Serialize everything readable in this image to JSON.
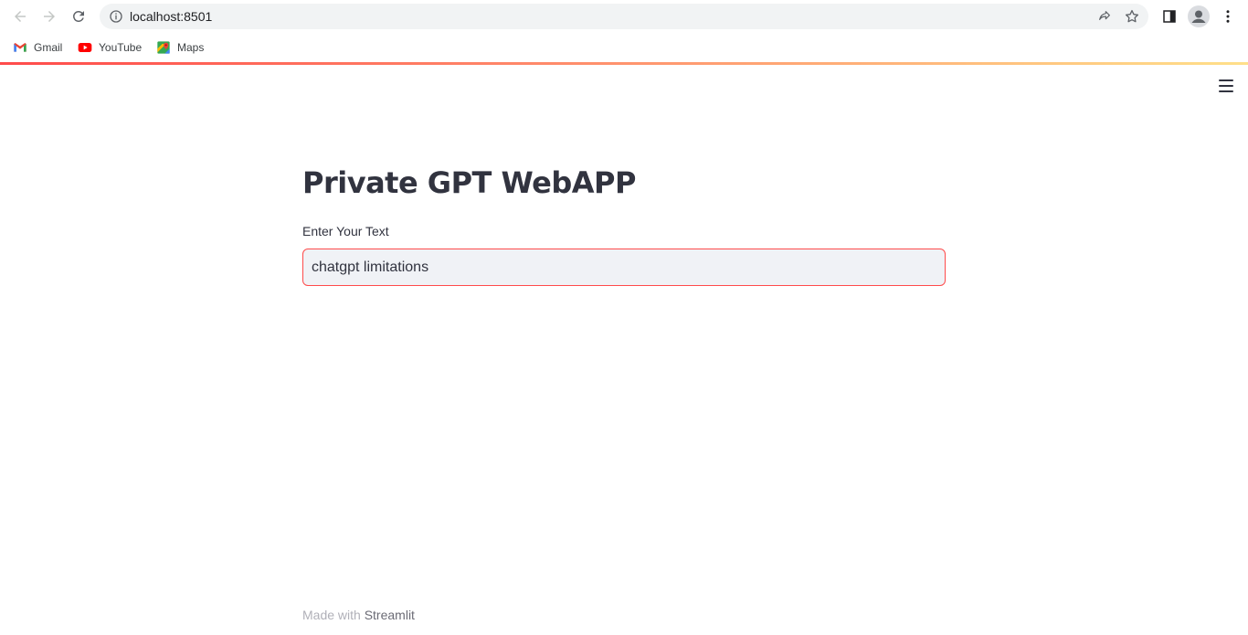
{
  "browser": {
    "url": "localhost:8501",
    "bookmarks": [
      {
        "label": "Gmail",
        "icon": "gmail-icon"
      },
      {
        "label": "YouTube",
        "icon": "youtube-icon"
      },
      {
        "label": "Maps",
        "icon": "maps-icon"
      }
    ]
  },
  "app": {
    "title": "Private GPT WebAPP",
    "input_label": "Enter Your Text",
    "input_value": "chatgpt limitations",
    "footer_prefix": "Made with ",
    "footer_brand": "Streamlit"
  },
  "colors": {
    "accent": "#ff4b4b",
    "text": "#31333f",
    "input_bg": "#f0f2f6"
  }
}
